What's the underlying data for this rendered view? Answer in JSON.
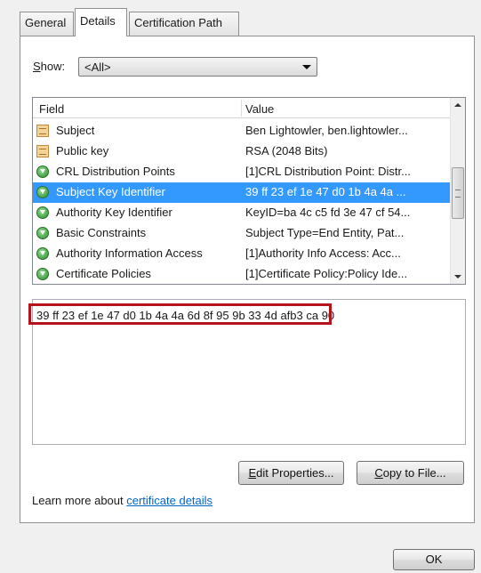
{
  "tabs": [
    {
      "label": "General"
    },
    {
      "label": "Details"
    },
    {
      "label": "Certification Path"
    }
  ],
  "show": {
    "label_key": "S",
    "label_rest": "how:",
    "value": "<All>"
  },
  "list": {
    "headers": {
      "field": "Field",
      "value": "Value"
    },
    "rows": [
      {
        "icon": "document-icon",
        "field": "Subject",
        "value": "Ben Lightowler, ben.lightowler..."
      },
      {
        "icon": "document-icon",
        "field": "Public key",
        "value": "RSA (2048 Bits)"
      },
      {
        "icon": "extension-icon",
        "field": "CRL Distribution Points",
        "value": "[1]CRL Distribution Point: Distr..."
      },
      {
        "icon": "extension-icon",
        "field": "Subject Key Identifier",
        "value": "39 ff 23 ef 1e 47 d0 1b 4a 4a ...",
        "selected": true
      },
      {
        "icon": "extension-icon",
        "field": "Authority Key Identifier",
        "value": "KeyID=ba 4c c5 fd 3e 47 cf 54..."
      },
      {
        "icon": "extension-icon",
        "field": "Basic Constraints",
        "value": "Subject Type=End Entity, Pat..."
      },
      {
        "icon": "extension-icon",
        "field": "Authority Information Access",
        "value": "[1]Authority Info Access: Acc..."
      },
      {
        "icon": "extension-icon",
        "field": "Certificate Policies",
        "value": "[1]Certificate Policy:Policy Ide..."
      }
    ]
  },
  "detail_value": "39 ff 23 ef 1e 47 d0 1b 4a 4a 6d 8f 95 9b 33 4d afb3 ca 90",
  "buttons": {
    "edit_key": "E",
    "edit_rest": "dit Properties...",
    "copy_key": "C",
    "copy_rest": "opy to File...",
    "ok": "OK"
  },
  "learn": {
    "prefix": "Learn more about ",
    "link": "certificate details"
  },
  "colors": {
    "selection": "#3399ff",
    "highlight_border": "#b5121b",
    "link": "#0066cc"
  }
}
